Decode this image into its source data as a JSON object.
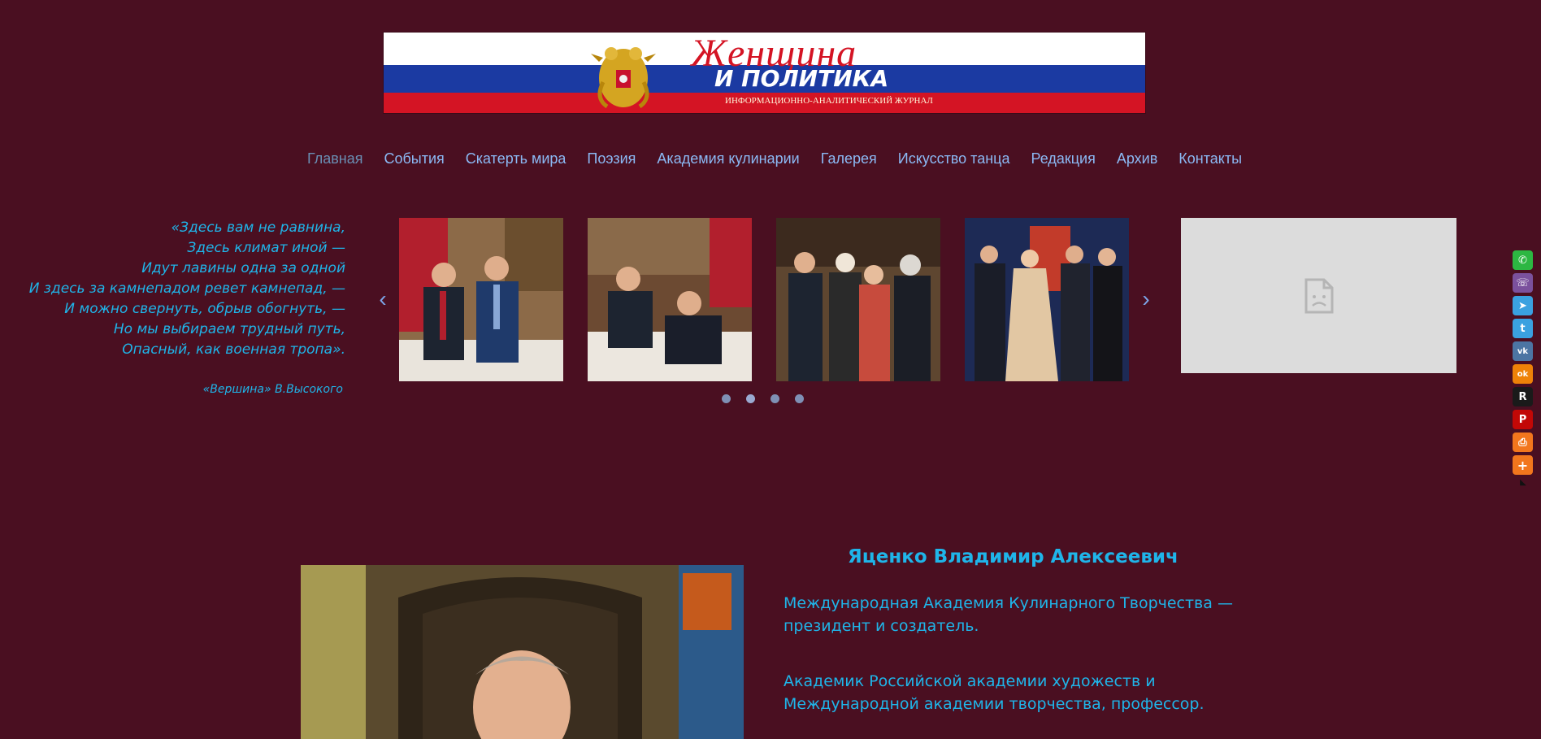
{
  "header": {
    "brand_line1": "Женщина",
    "brand_line2": "И ПОЛИТИКА",
    "brand_tagline": "ИНФОРМАЦИОННО-АНАЛИТИЧЕСКИЙ ЖУРНАЛ",
    "emblem_icon": "double-headed-eagle-icon",
    "flag_colors": [
      "#ffffff",
      "#1b3aa2",
      "#d41424"
    ]
  },
  "nav": {
    "items": [
      {
        "label": "Главная",
        "active": true
      },
      {
        "label": "События"
      },
      {
        "label": "Скатерть мира"
      },
      {
        "label": "Поэзия"
      },
      {
        "label": "Академия кулинарии"
      },
      {
        "label": "Галерея"
      },
      {
        "label": "Искусство танца"
      },
      {
        "label": "Редакция"
      },
      {
        "label": "Архив"
      },
      {
        "label": "Контакты"
      }
    ]
  },
  "quote": {
    "lines": [
      "«Здесь вам не равнина,",
      "Здесь климат иной —",
      "Идут лавины одна за одной",
      "И здесь за камнепадом ревет камнепад, —",
      "И можно свернуть, обрыв обогнуть, —",
      "Но мы выбираем трудный путь,",
      "Опасный, как военная тропа»."
    ],
    "source": "«Вершина» В.Высокого"
  },
  "carousel": {
    "prev_icon": "chevron-left-icon",
    "next_icon": "chevron-right-icon",
    "slides": 4,
    "active_dot": 1,
    "dot_count": 4
  },
  "video": {
    "icon": "broken-media-icon"
  },
  "share": {
    "buttons": [
      {
        "icon": "whatsapp-icon",
        "color": "#2cb742",
        "glyph": "✆"
      },
      {
        "icon": "viber-icon",
        "color": "#7b519d",
        "glyph": "☏"
      },
      {
        "icon": "telegram-icon",
        "color": "#3aa1e0",
        "glyph": "➤"
      },
      {
        "icon": "twitter-icon",
        "color": "#3aa1e0",
        "glyph": "t"
      },
      {
        "icon": "vk-icon",
        "color": "#4c75a3",
        "glyph": "vk"
      },
      {
        "icon": "odnoklassniki-icon",
        "color": "#ee8208",
        "glyph": "ok"
      },
      {
        "icon": "renren-icon",
        "color": "#1a1a1a",
        "glyph": "R"
      },
      {
        "icon": "pinterest-icon",
        "color": "#c20806",
        "glyph": "P"
      },
      {
        "icon": "print-icon",
        "color": "#f2761d",
        "glyph": "⎙"
      },
      {
        "icon": "more-icon",
        "color": "#f2761d",
        "glyph": "+"
      }
    ],
    "hide_glyph": "◣"
  },
  "bio": {
    "name": "Яценко Владимир Алексеевич",
    "paragraph1": "Международная Академия Кулинарного Творчества — президент и создатель.",
    "paragraph2": "Академик Российской академии художеств и Международной академии творчества, профессор."
  }
}
